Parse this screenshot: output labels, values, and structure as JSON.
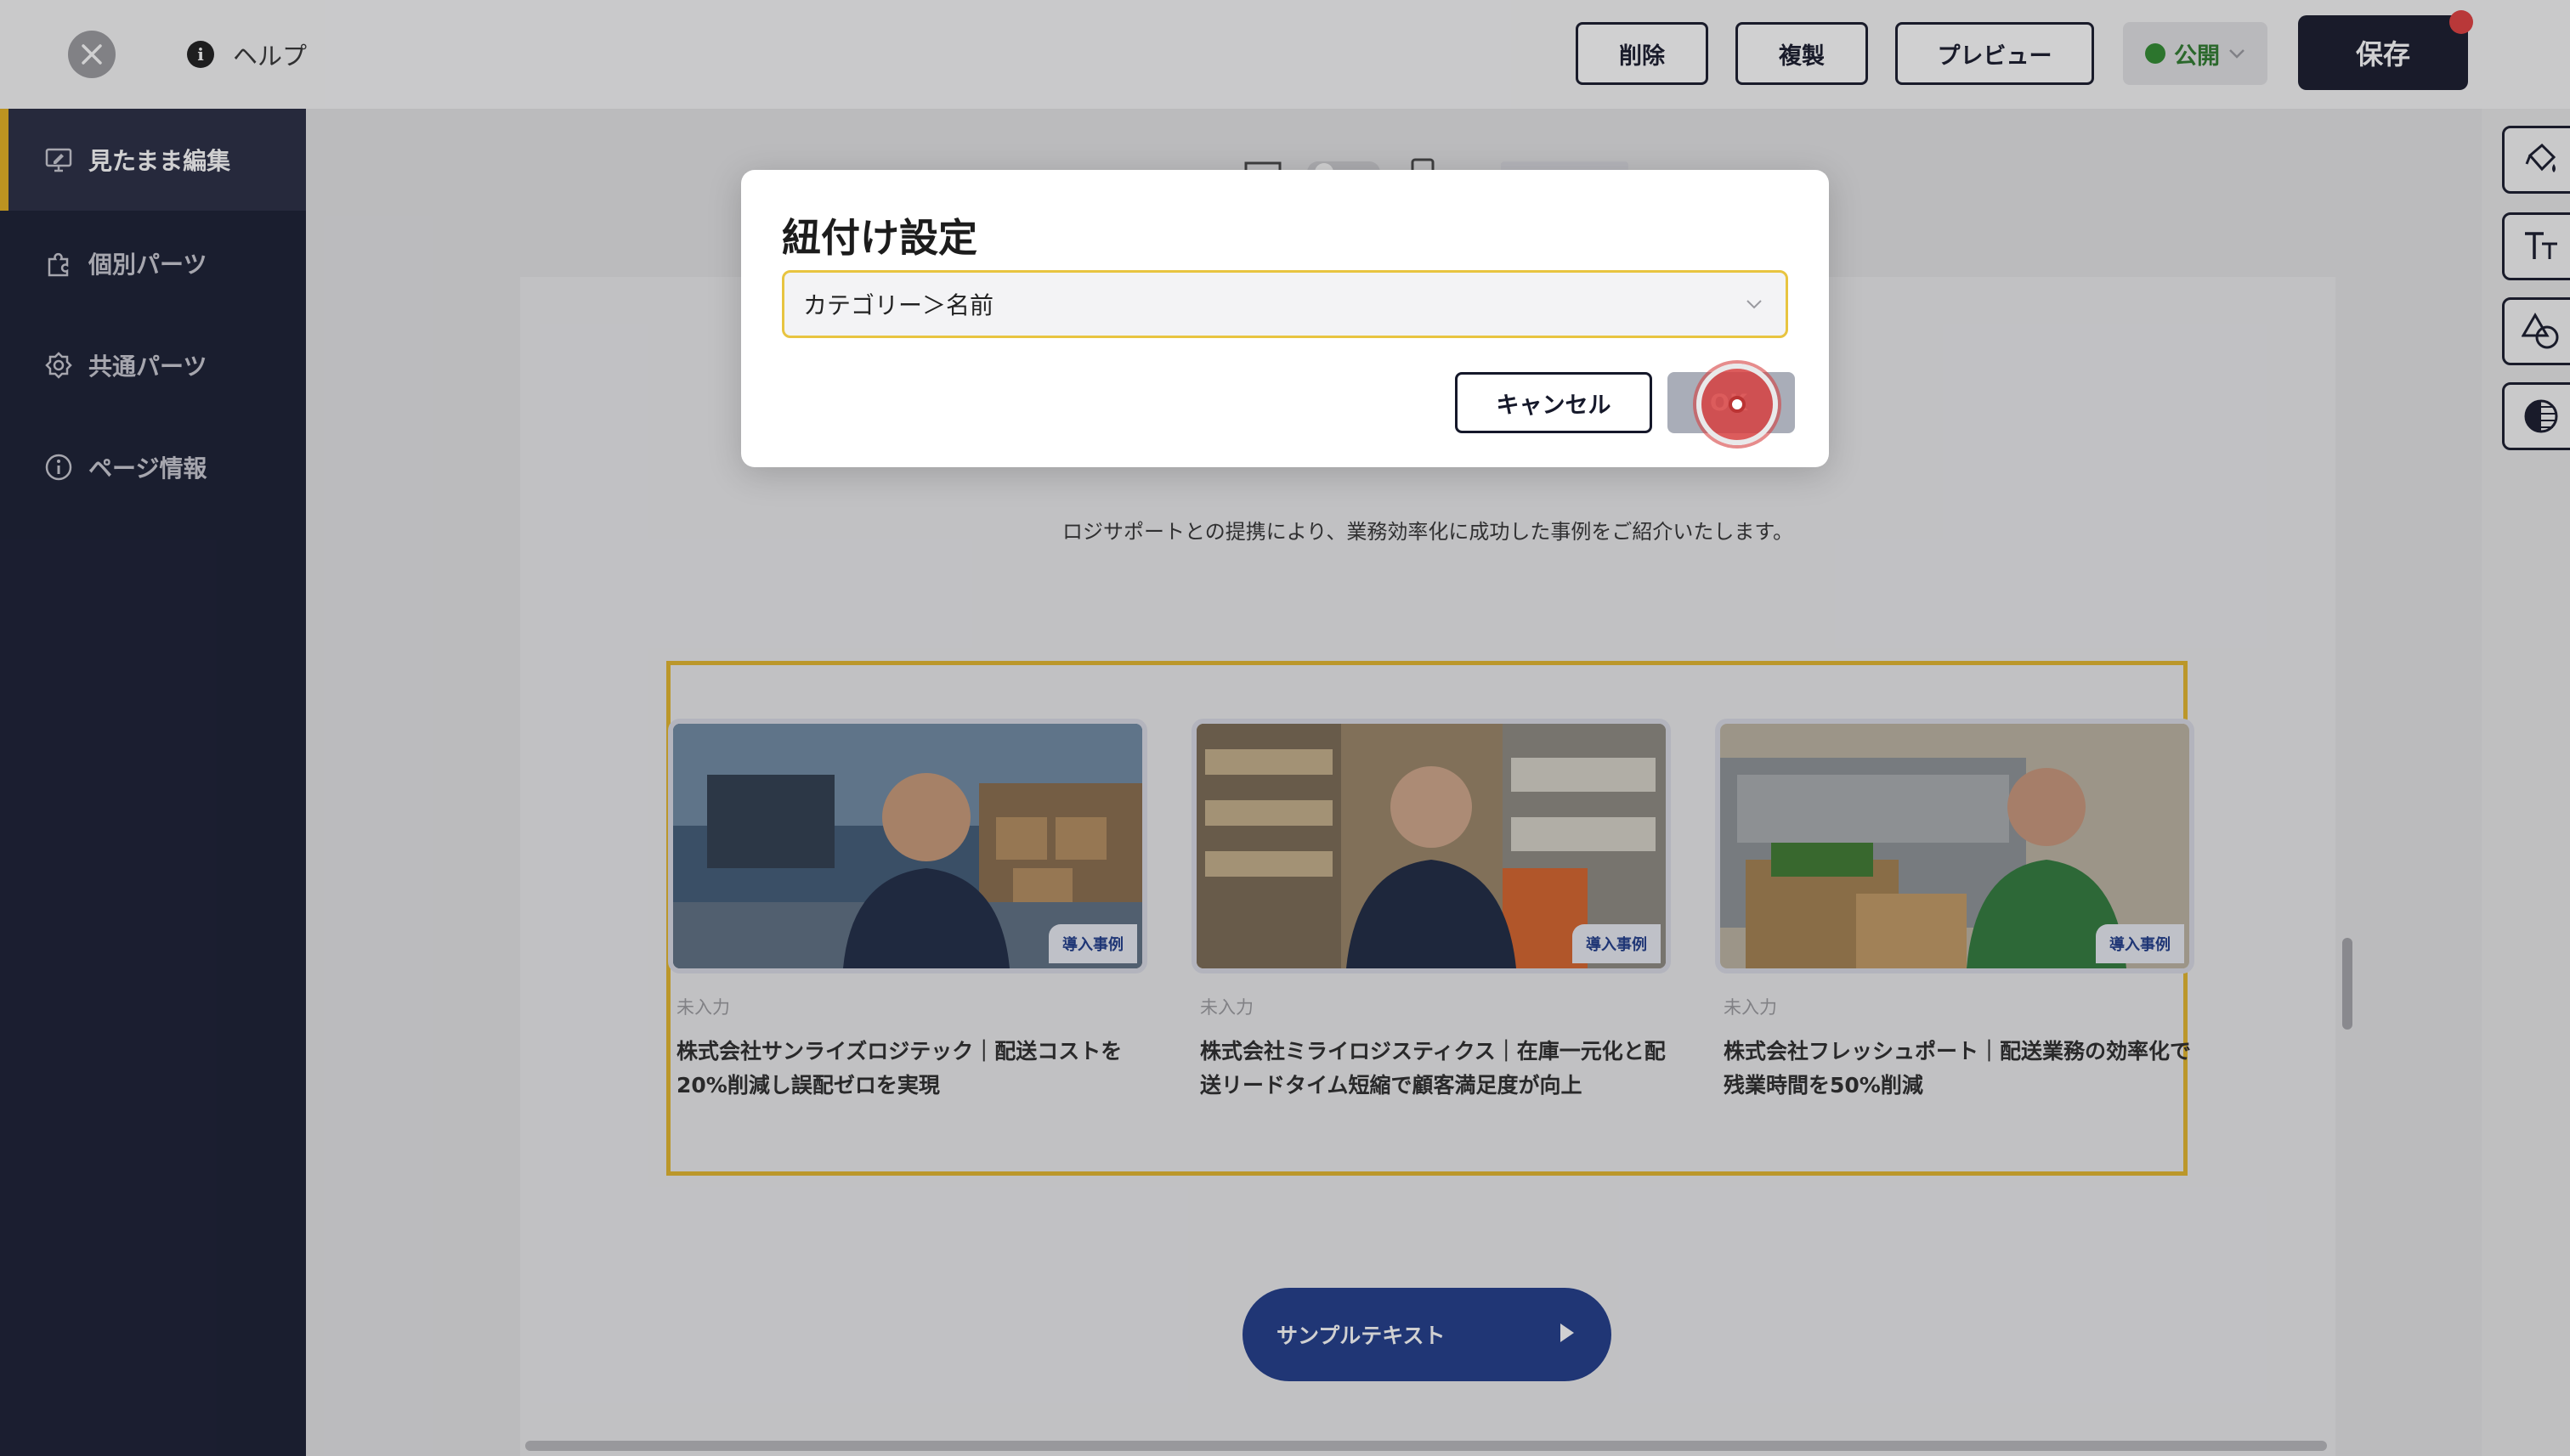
{
  "topbar": {
    "help_label": "ヘルプ",
    "delete_label": "削除",
    "duplicate_label": "複製",
    "preview_label": "プレビュー",
    "publish_label": "公開",
    "save_label": "保存"
  },
  "sidebar": {
    "items": [
      {
        "label": "見たまま編集",
        "icon": "monitor-edit-icon",
        "active": true
      },
      {
        "label": "個別パーツ",
        "icon": "puzzle-icon",
        "active": false
      },
      {
        "label": "共通パーツ",
        "icon": "badge-icon",
        "active": false
      },
      {
        "label": "ページ情報",
        "icon": "info-icon",
        "active": false
      }
    ]
  },
  "page": {
    "description": "ロジサポートとの提携により、業務効率化に成功した事例をご紹介いたします。",
    "cards": [
      {
        "tag": "導入事例",
        "category": "未入力",
        "title": "株式会社サンライズロジテック｜配送コストを20%削減し誤配ゼロを実現"
      },
      {
        "tag": "導入事例",
        "category": "未入力",
        "title": "株式会社ミライロジスティクス｜在庫一元化と配送リードタイム短縮で顧客満足度が向上"
      },
      {
        "tag": "導入事例",
        "category": "未入力",
        "title": "株式会社フレッシュポート｜配送業務の効率化で残業時間を50%削減"
      }
    ],
    "cta_label": "サンプルテキスト"
  },
  "modal": {
    "title": "紐付け設定",
    "select_value": "カテゴリー＞名前",
    "cancel_label": "キャンセル",
    "ok_label": "OK"
  },
  "colors": {
    "sidebar_bg": "#171b30",
    "accent_yellow": "#e6b11e",
    "primary_navy": "#15182a",
    "cta_blue": "#1e3a8a",
    "publish_green": "#2e8b2e",
    "badge_red": "#e23d3d"
  }
}
